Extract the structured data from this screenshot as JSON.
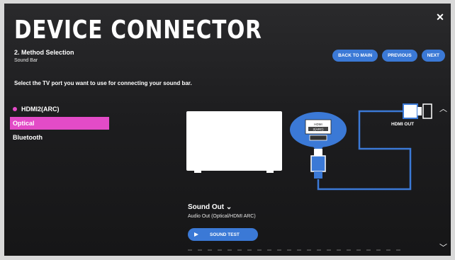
{
  "header": {
    "title": "DEVICE CONNECTOR",
    "step": "2. Method Selection",
    "device": "Sound Bar",
    "buttons": {
      "back": "BACK TO MAIN",
      "previous": "PREVIOUS",
      "next": "NEXT"
    }
  },
  "instruction": "Select the TV port you want to use for connecting your sound bar.",
  "ports": [
    {
      "label": "HDMI2(ARC)",
      "marked": true,
      "selected": false
    },
    {
      "label": "Optical",
      "marked": false,
      "selected": true
    },
    {
      "label": "Bluetooth",
      "marked": false,
      "selected": false
    }
  ],
  "diagram": {
    "port_label_line1": "HDMI",
    "port_label_line2": "2(ARC)",
    "hdmi_out_label": "HDMI OUT"
  },
  "sound_out": {
    "title": "Sound Out",
    "value": "Audio Out (Optical/HDMI ARC)",
    "test_button": "SOUND TEST"
  },
  "colors": {
    "accent": "#e34bc7",
    "button": "#3b79d6",
    "cable": "#3b79d6"
  },
  "icons": {
    "close": "close-icon",
    "dropdown": "chevron-down-icon",
    "play": "play-icon",
    "scroll_up": "chevron-up-icon",
    "scroll_down": "chevron-down-icon"
  }
}
